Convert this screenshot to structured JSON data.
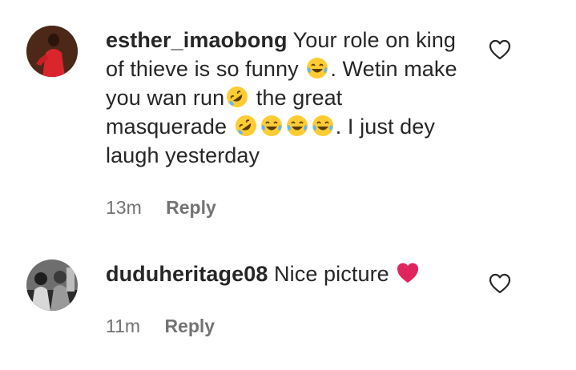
{
  "comments": [
    {
      "username": "esther_imaobong",
      "text_parts": {
        "p1": "Your role on king of thieve is so funny",
        "p2": ". Wetin make you wan run",
        "p3": " the great masquerade",
        "p4": ". I just dey laugh yesterday"
      },
      "emojis": [
        "face-with-tears-of-joy",
        "rolling-on-the-floor-laughing",
        "rolling-on-the-floor-laughing",
        "face-with-tears-of-joy",
        "face-with-tears-of-joy",
        "face-with-tears-of-joy"
      ],
      "time": "13m",
      "reply_label": "Reply",
      "like_icon": "heart-outline-icon"
    },
    {
      "username": "duduheritage08",
      "text_parts": {
        "p1": "Nice picture"
      },
      "emojis": [
        "red-heart"
      ],
      "time": "11m",
      "reply_label": "Reply",
      "like_icon": "heart-outline-icon"
    }
  ],
  "colors": {
    "text": "#262626",
    "secondary": "#737373",
    "heart": "#e0245e",
    "emoji_yellow": "#ffcc33"
  }
}
